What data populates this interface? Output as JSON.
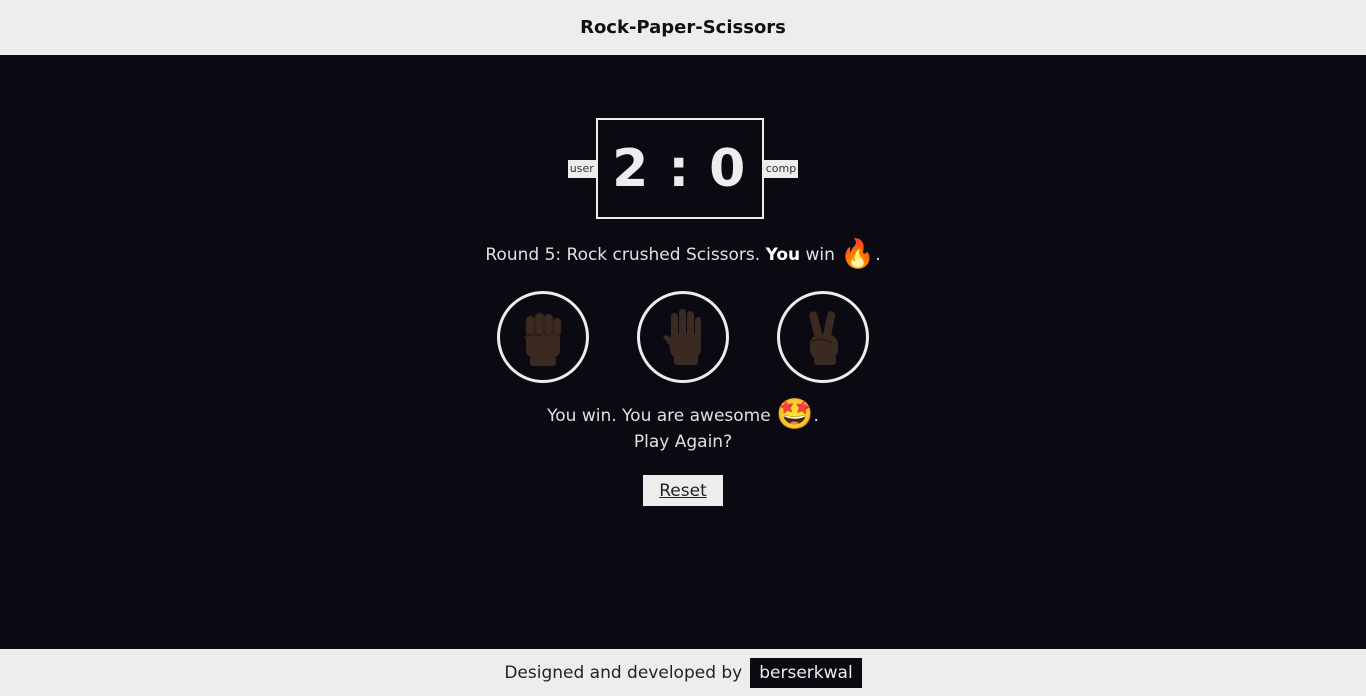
{
  "header": {
    "title": "Rock-Paper-Scissors"
  },
  "score": {
    "user_label": "user",
    "comp_label": "comp",
    "user_score": "2",
    "separator": ":",
    "comp_score": "0"
  },
  "round": {
    "prefix": "Round 5: Rock crushed Scissors.",
    "you": "You",
    "win": "win",
    "emoji": "🔥",
    "end": "."
  },
  "choices": [
    {
      "name": "rock",
      "icon": "raised-fist-icon"
    },
    {
      "name": "paper",
      "icon": "raised-hand-icon"
    },
    {
      "name": "scissors",
      "icon": "victory-hand-icon"
    }
  ],
  "result": {
    "line1": "You win. You are awesome",
    "emoji": "🤩",
    "end": ".",
    "line2": "Play Again?"
  },
  "reset_label": "Reset",
  "footer": {
    "text": "Designed and developed by",
    "author": "berserkwal"
  },
  "colors": {
    "background": "#0b0a13",
    "bar": "#ededed",
    "hand": "#3b2a22"
  }
}
